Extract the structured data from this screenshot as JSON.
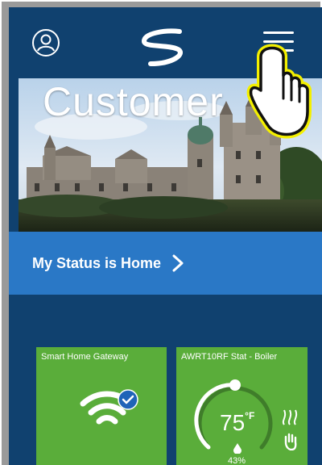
{
  "header": {
    "profile_icon": "user-icon",
    "logo_icon": "swirl-logo-icon",
    "menu_icon": "hamburger-menu-icon"
  },
  "hero": {
    "title": "Customer"
  },
  "status": {
    "label": "My Status is Home",
    "chevron_icon": "chevron-right-icon"
  },
  "tiles": [
    {
      "title": "Smart Home Gateway",
      "icon": "wifi-icon",
      "badge_icon": "check-badge-icon"
    },
    {
      "title": "AWRT10RF Stat - Boiler",
      "temperature": "75",
      "unit": "°F",
      "humidity": "43%",
      "icons": [
        "heat-waves-icon",
        "manual-hand-icon",
        "water-drop-icon"
      ]
    }
  ],
  "overlay": {
    "pointer_icon": "pointing-hand-icon"
  },
  "colors": {
    "background": "#10416f",
    "status_bar": "#2a78c6",
    "tile_green": "#5aad3a",
    "highlight": "#f4f000"
  }
}
